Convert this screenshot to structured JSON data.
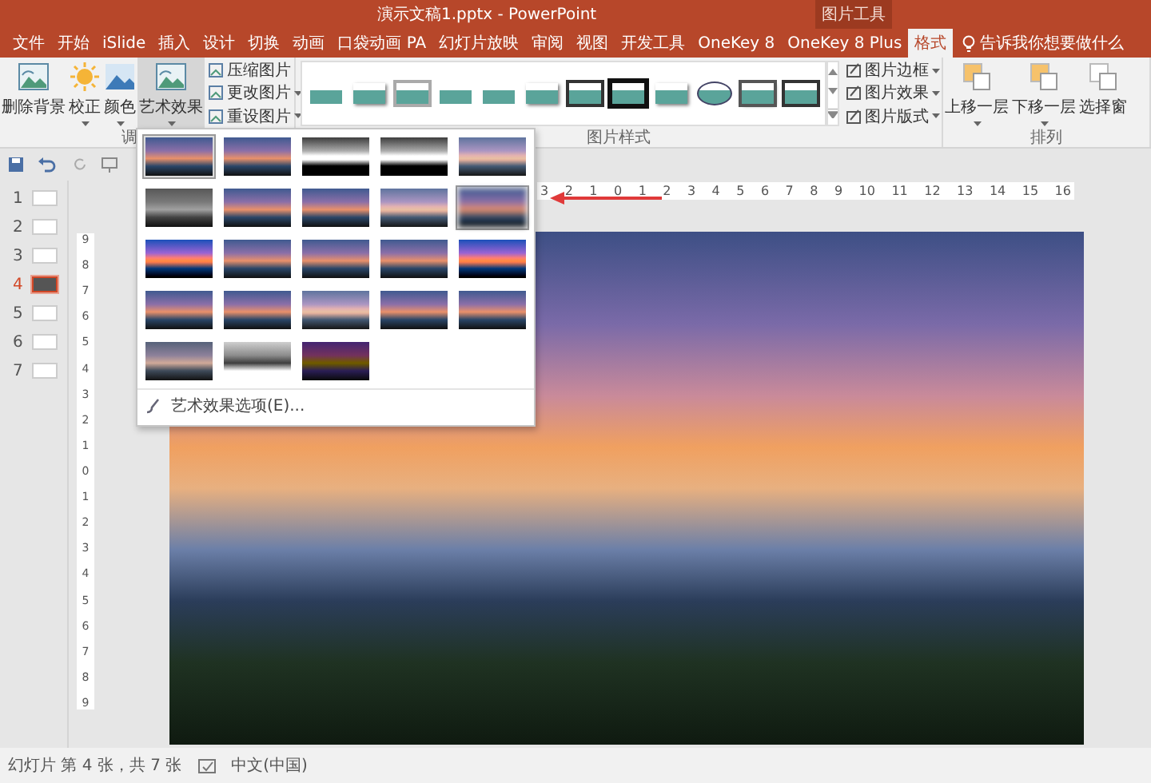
{
  "window": {
    "title": "演示文稿1.pptx - PowerPoint",
    "context_label": "图片工具"
  },
  "tabs": [
    {
      "label": "文件",
      "selected": false
    },
    {
      "label": "开始",
      "selected": false
    },
    {
      "label": "iSlide",
      "selected": false
    },
    {
      "label": "插入",
      "selected": false
    },
    {
      "label": "设计",
      "selected": false
    },
    {
      "label": "切换",
      "selected": false
    },
    {
      "label": "动画",
      "selected": false
    },
    {
      "label": "口袋动画 PA",
      "selected": false
    },
    {
      "label": "幻灯片放映",
      "selected": false
    },
    {
      "label": "审阅",
      "selected": false
    },
    {
      "label": "视图",
      "selected": false
    },
    {
      "label": "开发工具",
      "selected": false
    },
    {
      "label": "OneKey 8",
      "selected": false
    },
    {
      "label": "OneKey 8 Plus",
      "selected": false
    },
    {
      "label": "格式",
      "selected": true
    }
  ],
  "tell_me": "告诉我你想要做什么",
  "adjust_group": {
    "label": "调",
    "big_buttons": [
      {
        "label": "删除背景",
        "dropdown": false,
        "pressed": false
      },
      {
        "label": "校正",
        "dropdown": true,
        "pressed": false
      },
      {
        "label": "颜色",
        "dropdown": true,
        "pressed": false
      },
      {
        "label": "艺术效果",
        "dropdown": true,
        "pressed": true
      }
    ],
    "small_buttons": [
      {
        "label": "压缩图片",
        "dropdown": false
      },
      {
        "label": "更改图片",
        "dropdown": true
      },
      {
        "label": "重设图片",
        "dropdown": true
      }
    ]
  },
  "styles_group": {
    "label": "图片样式",
    "gallery": [
      {
        "kind": "plain"
      },
      {
        "kind": "shadow"
      },
      {
        "kind": "gray"
      },
      {
        "kind": "plain"
      },
      {
        "kind": "plain"
      },
      {
        "kind": "shadow"
      },
      {
        "kind": "black"
      },
      {
        "kind": "thick"
      },
      {
        "kind": "shadow"
      },
      {
        "kind": "oval"
      },
      {
        "kind": "dark"
      },
      {
        "kind": "black"
      }
    ],
    "small_buttons": [
      {
        "label": "图片边框",
        "dropdown": true
      },
      {
        "label": "图片效果",
        "dropdown": true
      },
      {
        "label": "图片版式",
        "dropdown": true
      }
    ]
  },
  "arrange_group": {
    "label": "排列",
    "big_buttons": [
      {
        "label": "上移一层",
        "dropdown": true
      },
      {
        "label": "下移一层",
        "dropdown": true
      },
      {
        "label": "选择窗",
        "dropdown": false
      }
    ]
  },
  "slides": [
    {
      "number": "1",
      "selected": false
    },
    {
      "number": "2",
      "selected": false
    },
    {
      "number": "3",
      "selected": false
    },
    {
      "number": "4",
      "selected": true
    },
    {
      "number": "5",
      "selected": false
    },
    {
      "number": "6",
      "selected": false
    },
    {
      "number": "7",
      "selected": false
    }
  ],
  "horizontal_ruler": [
    "3",
    "2",
    "1",
    "0",
    "1",
    "2",
    "3",
    "4",
    "5",
    "6",
    "7",
    "8",
    "9",
    "10",
    "11",
    "12",
    "13",
    "14",
    "15",
    "16"
  ],
  "vertical_ruler": [
    "9",
    "8",
    "7",
    "6",
    "5",
    "4",
    "3",
    "2",
    "1",
    "0",
    "1",
    "2",
    "3",
    "4",
    "5",
    "6",
    "7",
    "8",
    "9"
  ],
  "art_effects": {
    "items": [
      {
        "kind": "normal",
        "selected": true
      },
      {
        "kind": "normal",
        "selected": false
      },
      {
        "kind": "sketch",
        "selected": false
      },
      {
        "kind": "sketch",
        "selected": false
      },
      {
        "kind": "bright",
        "selected": false
      },
      {
        "kind": "gray",
        "selected": false
      },
      {
        "kind": "normal",
        "selected": false
      },
      {
        "kind": "normal",
        "selected": false
      },
      {
        "kind": "bright",
        "selected": false
      },
      {
        "kind": "blur",
        "selected": true
      },
      {
        "kind": "mosaic",
        "selected": false
      },
      {
        "kind": "normal",
        "selected": false
      },
      {
        "kind": "normal",
        "selected": false
      },
      {
        "kind": "normal",
        "selected": false
      },
      {
        "kind": "mosaic",
        "selected": false
      },
      {
        "kind": "normal",
        "selected": false
      },
      {
        "kind": "normal",
        "selected": false
      },
      {
        "kind": "bright",
        "selected": false
      },
      {
        "kind": "normal",
        "selected": false
      },
      {
        "kind": "normal",
        "selected": false
      },
      {
        "kind": "pastel",
        "selected": false
      },
      {
        "kind": "invert",
        "selected": false
      },
      {
        "kind": "dark",
        "selected": false
      }
    ],
    "options_link": "艺术效果选项(E)..."
  },
  "status_bar": {
    "slide_info": "幻灯片 第 4 张，共 7 张",
    "language": "中文(中国)"
  }
}
